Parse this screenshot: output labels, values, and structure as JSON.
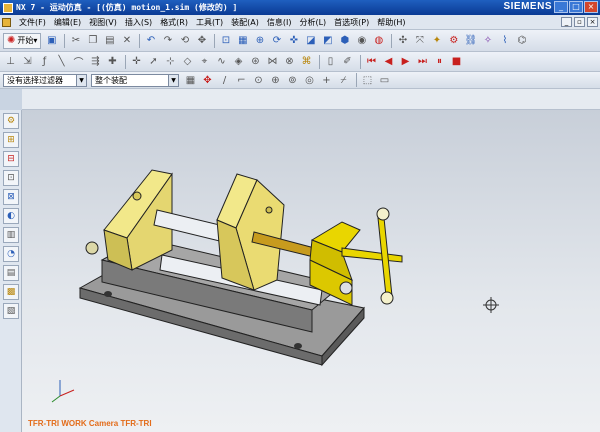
{
  "window": {
    "title": "NX 7 - 运动仿真 - [(仿真) motion_1.sim (修改的) ]",
    "brand": "SIEMENS",
    "buttons": {
      "minimize": "_",
      "maximize": "□",
      "close": "×"
    }
  },
  "menu": {
    "items": [
      "文件(F)",
      "编辑(E)",
      "视图(V)",
      "插入(S)",
      "格式(R)",
      "工具(T)",
      "装配(A)",
      "信息(I)",
      "分析(L)",
      "首选项(P)",
      "帮助(H)"
    ]
  },
  "toolbar1": {
    "start_label": "开始"
  },
  "toolbar3": {
    "filter": "没有选择过滤器",
    "scope": "整个装配"
  },
  "viewport": {
    "status": "TFR-TRI WORK Camera TFR-TRI"
  },
  "colors": {
    "titlebar": "#0a3a94",
    "viewport_top": "#c8cfd9",
    "part_yellow": "#f2e88a",
    "screw_yellow": "#e9d600",
    "status_orange": "#e36c1a"
  },
  "icons": [
    "save-icon",
    "undo-icon",
    "redo-icon",
    "cut-icon",
    "copy-icon",
    "paste-icon",
    "delete-icon",
    "zoom-icon",
    "rotate-icon",
    "pan-icon",
    "fit-icon",
    "shaded-icon",
    "play-icon",
    "stop-icon",
    "rewind-icon",
    "forward-icon",
    "crosshair-icon"
  ]
}
